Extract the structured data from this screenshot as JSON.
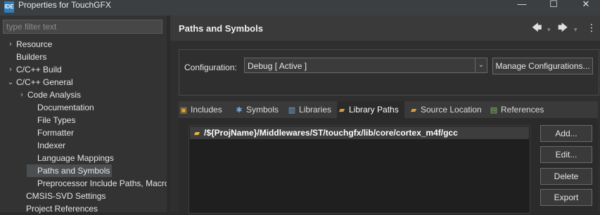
{
  "window": {
    "title": "Properties for TouchGFX",
    "app_badge": "IDE",
    "controls": {
      "minimize": "—",
      "maximize": "☐",
      "close": "✕"
    }
  },
  "left_pane": {
    "filter_placeholder": "type filter text",
    "tree": [
      {
        "label": "Resource",
        "expander": "›",
        "selected": false
      },
      {
        "label": "Builders",
        "expander": "",
        "selected": false
      },
      {
        "label": "C/C++ Build",
        "expander": "›",
        "selected": false
      },
      {
        "label": "C/C++ General",
        "expander": "⌄",
        "selected": false
      },
      {
        "label": "Code Analysis",
        "expander": "›",
        "selected": false
      },
      {
        "label": "Documentation",
        "expander": "",
        "selected": false
      },
      {
        "label": "File Types",
        "expander": "",
        "selected": false
      },
      {
        "label": "Formatter",
        "expander": "",
        "selected": false
      },
      {
        "label": "Indexer",
        "expander": "",
        "selected": false
      },
      {
        "label": "Language Mappings",
        "expander": "",
        "selected": false
      },
      {
        "label": "Paths and Symbols",
        "expander": "",
        "selected": true
      },
      {
        "label": "Preprocessor Include Paths, Macros",
        "expander": "",
        "selected": false
      },
      {
        "label": "CMSIS-SVD Settings",
        "expander": "",
        "selected": false
      },
      {
        "label": "Project References",
        "expander": "",
        "selected": false
      }
    ]
  },
  "page": {
    "title": "Paths and Symbols",
    "nav": {
      "back": "🡄",
      "forward": "🡆",
      "dropdown": "▾",
      "menu": "⋮"
    }
  },
  "configuration": {
    "label": "Configuration:",
    "value": "Debug  [ Active ]",
    "arrow": "⌄",
    "manage_button": "Manage Configurations..."
  },
  "tabs": [
    {
      "label": "Includes",
      "icon": "includes-icon",
      "glyph": "▣",
      "active": false
    },
    {
      "label": "Symbols",
      "icon": "symbols-icon",
      "glyph": "✱",
      "active": false
    },
    {
      "label": "Libraries",
      "icon": "libraries-icon",
      "glyph": "▥",
      "active": false
    },
    {
      "label": "Library Paths",
      "icon": "folder-open-icon",
      "glyph": "▰",
      "active": true
    },
    {
      "label": "Source Location",
      "icon": "source-folder-icon",
      "glyph": "▰",
      "active": false
    },
    {
      "label": "References",
      "icon": "references-icon",
      "glyph": "▤",
      "active": false
    }
  ],
  "library_paths": {
    "items": [
      "/${ProjName}/Middlewares/ST/touchgfx/lib/core/cortex_m4f/gcc"
    ],
    "buttons": {
      "add": "Add...",
      "edit": "Edit...",
      "delete": "Delete",
      "export": "Export"
    }
  },
  "colors": {
    "badge": "#2d7fc1",
    "folder": "#e8b54a",
    "selection": "#4b4f52"
  }
}
